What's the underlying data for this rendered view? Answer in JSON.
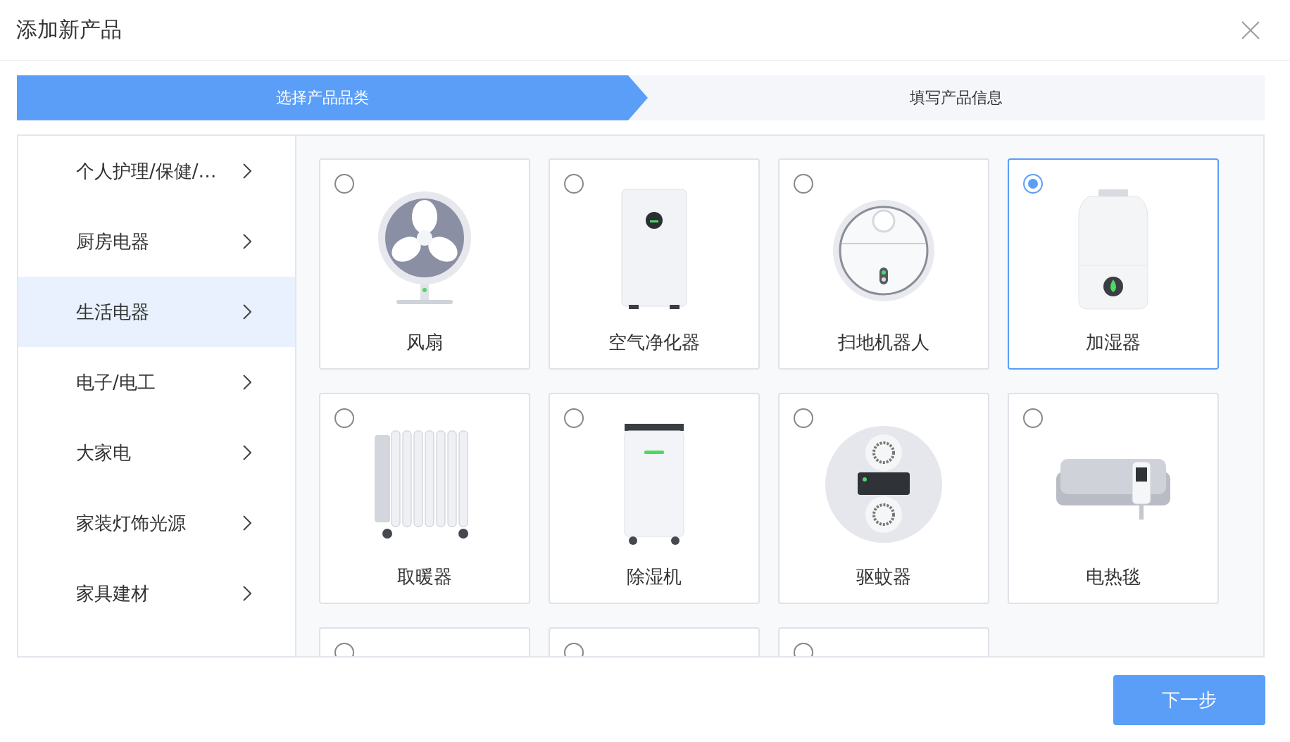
{
  "dialog": {
    "title": "添加新产品"
  },
  "steps": [
    {
      "label": "选择产品品类",
      "selected": true
    },
    {
      "label": "填写产品信息",
      "selected": false
    }
  ],
  "categories": [
    {
      "label": "个人护理/保健/…",
      "selected": false
    },
    {
      "label": "厨房电器",
      "selected": false
    },
    {
      "label": "生活电器",
      "selected": true
    },
    {
      "label": "电子/电工",
      "selected": false
    },
    {
      "label": "大家电",
      "selected": false
    },
    {
      "label": "家装灯饰光源",
      "selected": false
    },
    {
      "label": "家具建材",
      "selected": false
    }
  ],
  "products": [
    {
      "kind": "fan",
      "label": "风扇",
      "selected": false
    },
    {
      "kind": "purifier",
      "label": "空气净化器",
      "selected": false
    },
    {
      "kind": "robot",
      "label": "扫地机器人",
      "selected": false
    },
    {
      "kind": "humidifier",
      "label": "加湿器",
      "selected": true
    },
    {
      "kind": "heater",
      "label": "取暖器",
      "selected": false
    },
    {
      "kind": "dehumidifier",
      "label": "除湿机",
      "selected": false
    },
    {
      "kind": "repeller",
      "label": "驱蚊器",
      "selected": false
    },
    {
      "kind": "blanket",
      "label": "电热毯",
      "selected": false
    },
    {
      "kind": "hidden",
      "selected": false
    },
    {
      "kind": "hidden",
      "selected": false
    },
    {
      "kind": "hidden",
      "selected": false
    }
  ],
  "next_button": "下一步"
}
